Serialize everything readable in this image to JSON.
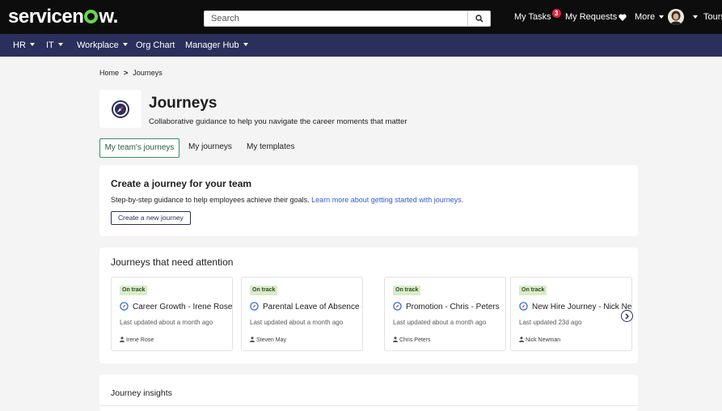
{
  "header": {
    "logo_text_pre": "servicen",
    "logo_text_post": "w.",
    "search_placeholder": "Search",
    "my_tasks": "My Tasks",
    "tasks_count": "3",
    "my_requests": "My Requests",
    "more": "More",
    "tours": "Tours"
  },
  "nav": {
    "hr": "HR",
    "it": "IT",
    "workplace": "Workplace",
    "org_chart": "Org Chart",
    "manager_hub": "Manager Hub"
  },
  "breadcrumb": {
    "home": "Home",
    "separator": ">",
    "current": "Journeys"
  },
  "page": {
    "title": "Journeys",
    "subtitle": "Collaborative guidance to help you navigate the career moments that matter"
  },
  "tabs": [
    {
      "label": "My team's journeys",
      "active": true
    },
    {
      "label": "My journeys",
      "active": false
    },
    {
      "label": "My templates",
      "active": false
    }
  ],
  "create_card": {
    "title": "Create a journey for your team",
    "description": "Step-by-step guidance to help employees achieve their goals.",
    "link": "Learn more about getting started with journeys.",
    "button": "Create a new journey"
  },
  "attention": {
    "title": "Journeys that need attention",
    "journeys": [
      {
        "status": "On track",
        "name": "Career Growth - Irene Rose",
        "updated": "Last updated about a month ago",
        "person": "Irene Rose"
      },
      {
        "status": "On track",
        "name": "Parental Leave of Absence - ...",
        "updated": "Last updated about a month ago",
        "person": "Steven May"
      },
      {
        "status": "On track",
        "name": "Promotion - Chris - Peters",
        "updated": "Last updated about a month ago",
        "person": "Chris Peters"
      },
      {
        "status": "On track",
        "name": "New Hire Journey - Nick Newman",
        "updated": "Last updated 23d ago",
        "person": "Nick Newman"
      }
    ]
  },
  "insights": {
    "title": "Journey insights"
  },
  "colors": {
    "topbar": "#0d0d0d",
    "secondary_nav": "#2b2f5b",
    "logo_accent": "#62d84e",
    "active_tab_border": "#3a8c68",
    "status_pill": "#d9ecc9",
    "link": "#2f5bd9",
    "badge": "#e0233b"
  }
}
